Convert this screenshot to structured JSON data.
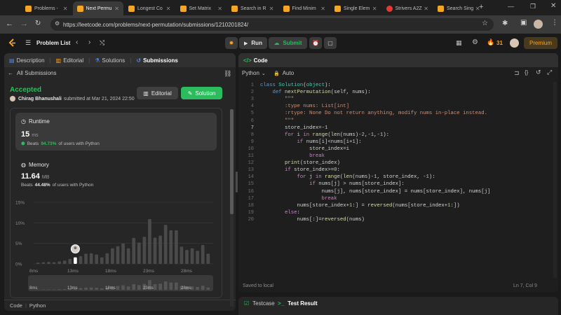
{
  "browser": {
    "tabs": [
      {
        "label": "Problems -",
        "active": false,
        "favicon": "leetcode"
      },
      {
        "label": "Next Permu",
        "active": true,
        "favicon": "leetcode"
      },
      {
        "label": "Longest Co",
        "active": false,
        "favicon": "leetcode"
      },
      {
        "label": "Set Matrix",
        "active": false,
        "favicon": "leetcode"
      },
      {
        "label": "Search in R",
        "active": false,
        "favicon": "leetcode"
      },
      {
        "label": "Find Minim",
        "active": false,
        "favicon": "leetcode"
      },
      {
        "label": "Single Elem",
        "active": false,
        "favicon": "leetcode"
      },
      {
        "label": "Strivers A2Z",
        "active": false,
        "favicon": "youtube"
      },
      {
        "label": "Search Sing",
        "active": false,
        "favicon": "leetcode"
      }
    ],
    "url": "https://leetcode.com/problems/next-permutation/submissions/1210201824/"
  },
  "header": {
    "problem_list": "Problem List",
    "run": "Run",
    "submit": "Submit",
    "streak": "31",
    "premium": "Premium"
  },
  "left": {
    "tabs": [
      "Description",
      "Editorial",
      "Solutions",
      "Submissions"
    ],
    "all_submissions": "All Submissions",
    "status": "Accepted",
    "user": "Chirag Bhanushali",
    "submitted": "submitted at Mar 21, 2024 22:50",
    "editorial_btn": "Editorial",
    "solution_btn": "Solution",
    "runtime": {
      "title": "Runtime",
      "value": "15",
      "unit": "ms",
      "beats_prefix": "Beats",
      "beats_pct": "94.73%",
      "beats_suffix": "of users with Python"
    },
    "memory": {
      "title": "Memory",
      "value": "11.64",
      "unit": "MB",
      "beats_prefix": "Beats",
      "beats_pct": "44.48%",
      "beats_suffix": "of users with Python"
    },
    "footer_code": "Code",
    "footer_lang": "Python"
  },
  "chart_data": {
    "type": "bar",
    "y_ticks": [
      "15%",
      "10%",
      "5%",
      "0%"
    ],
    "ylim": [
      0,
      15
    ],
    "x_ticks": [
      "8ms",
      "13ms",
      "18ms",
      "23ms",
      "28ms"
    ],
    "values": [
      0.3,
      0.4,
      0.5,
      0.4,
      0.6,
      0.8,
      1.2,
      1.6,
      1.9,
      2.5,
      2.6,
      2.3,
      1.6,
      2.6,
      3.8,
      4.3,
      5.0,
      3.8,
      6.3,
      5.2,
      6.6,
      10.9,
      6.4,
      6.9,
      9.5,
      8.2,
      8.2,
      4.2,
      3.4,
      3.8,
      3.2,
      4.6,
      2.5
    ],
    "highlight_index": 7,
    "mini_x_ticks": [
      "8ms",
      "13ms",
      "18ms",
      "23ms",
      "28ms"
    ]
  },
  "editor": {
    "title": "Code",
    "language": "Python",
    "auto": "Auto",
    "saved": "Saved to local",
    "position": "Ln 7, Col 9",
    "lines": [
      [
        [
          "kw",
          "class "
        ],
        [
          "bi",
          "Solution"
        ],
        [
          "plain",
          "("
        ],
        [
          "bi",
          "object"
        ],
        [
          "plain",
          "):"
        ]
      ],
      [
        [
          "plain",
          "    "
        ],
        [
          "kw",
          "def "
        ],
        [
          "fn",
          "nextPermutation"
        ],
        [
          "plain",
          "(self, nums):"
        ]
      ],
      [
        [
          "plain",
          "        "
        ],
        [
          "str",
          "\"\"\""
        ]
      ],
      [
        [
          "plain",
          "        "
        ],
        [
          "str",
          ":type nums: List[int]"
        ]
      ],
      [
        [
          "plain",
          "        "
        ],
        [
          "str",
          ":rtype: None Do not return anything, modify nums in-place instead."
        ]
      ],
      [
        [
          "plain",
          "        "
        ],
        [
          "str",
          "\"\"\""
        ]
      ],
      [
        [
          "plain",
          "        store_index=-"
        ],
        [
          "num",
          "1"
        ]
      ],
      [
        [
          "plain",
          "        "
        ],
        [
          "kwc",
          "for "
        ],
        [
          "plain",
          "i "
        ],
        [
          "kwc",
          "in "
        ],
        [
          "fn",
          "range"
        ],
        [
          "plain",
          "("
        ],
        [
          "fn",
          "len"
        ],
        [
          "plain",
          "(nums)-"
        ],
        [
          "num",
          "2"
        ],
        [
          "plain",
          ",-"
        ],
        [
          "num",
          "1"
        ],
        [
          "plain",
          ",-"
        ],
        [
          "num",
          "1"
        ],
        [
          "plain",
          "):"
        ]
      ],
      [
        [
          "plain",
          "            "
        ],
        [
          "kwc",
          "if "
        ],
        [
          "plain",
          "nums[i]<nums[i+"
        ],
        [
          "num",
          "1"
        ],
        [
          "plain",
          "]:"
        ]
      ],
      [
        [
          "plain",
          "                store_index=i"
        ]
      ],
      [
        [
          "plain",
          "                "
        ],
        [
          "kwc",
          "break"
        ]
      ],
      [
        [
          "plain",
          "        "
        ],
        [
          "fn",
          "print"
        ],
        [
          "plain",
          "(store_index)"
        ]
      ],
      [
        [
          "plain",
          "        "
        ],
        [
          "kwc",
          "if "
        ],
        [
          "plain",
          "store_index>="
        ],
        [
          "num",
          "0"
        ],
        [
          "plain",
          ":"
        ]
      ],
      [
        [
          "plain",
          "            "
        ],
        [
          "kwc",
          "for "
        ],
        [
          "plain",
          "j "
        ],
        [
          "kwc",
          "in "
        ],
        [
          "fn",
          "range"
        ],
        [
          "plain",
          "("
        ],
        [
          "fn",
          "len"
        ],
        [
          "plain",
          "(nums)-"
        ],
        [
          "num",
          "1"
        ],
        [
          "plain",
          ", store_index, -"
        ],
        [
          "num",
          "1"
        ],
        [
          "plain",
          "):"
        ]
      ],
      [
        [
          "plain",
          "                "
        ],
        [
          "kwc",
          "if "
        ],
        [
          "plain",
          "nums[j] > nums[store_index]:"
        ]
      ],
      [
        [
          "plain",
          "                    nums[j], nums[store_index] = nums[store_index], nums[j]"
        ]
      ],
      [
        [
          "plain",
          "                    "
        ],
        [
          "kwc",
          "break"
        ]
      ],
      [
        [
          "plain",
          "            nums[store_index+"
        ],
        [
          "num",
          "1"
        ],
        [
          "plain",
          ":] = "
        ],
        [
          "fn",
          "reversed"
        ],
        [
          "plain",
          "(nums[store_index+"
        ],
        [
          "num",
          "1"
        ],
        [
          "plain",
          ":])"
        ]
      ],
      [
        [
          "plain",
          "        "
        ],
        [
          "kwc",
          "else"
        ],
        [
          "plain",
          ":"
        ]
      ],
      [
        [
          "plain",
          "            nums[:]="
        ],
        [
          "fn",
          "reversed"
        ],
        [
          "plain",
          "(nums)"
        ]
      ]
    ]
  },
  "bottom": {
    "testcase": "Testcase",
    "test_result": "Test Result"
  },
  "colors": {
    "accepted": "#2cbb5d",
    "solution_btn": "#2cbb5d",
    "premium": "#ffa116",
    "streak": "#ffa116"
  }
}
